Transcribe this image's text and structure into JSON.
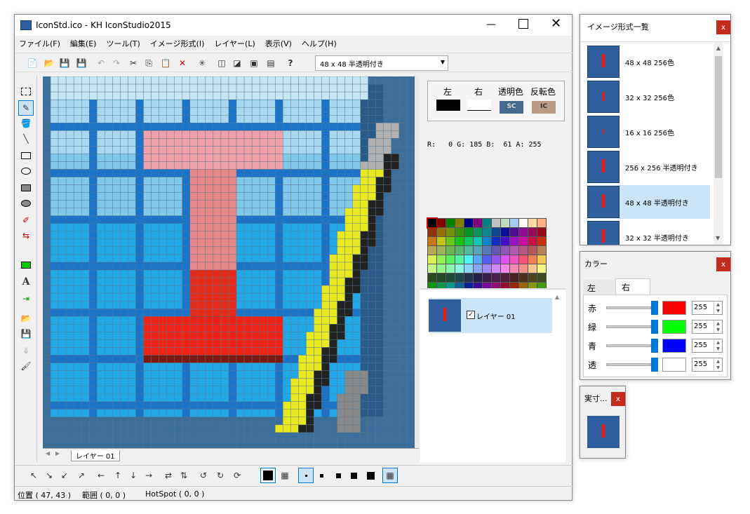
{
  "main": {
    "title": "IconStd.ico - KH IconStudio2015",
    "menu": [
      "ファイル(F)",
      "編集(E)",
      "ツール(T)",
      "イメージ形式(I)",
      "レイヤー(L)",
      "表示(V)",
      "ヘルプ(H)"
    ],
    "format_select": "48 x 48 半透明付き",
    "layer_tab": "レイヤー 01",
    "status": {
      "pos": "位置 ( 47, 43 )",
      "range": "範囲 ( 0, 0 )",
      "hotspot": "HotSpot ( 0, 0 )"
    }
  },
  "colors_panel": {
    "left_label": "左",
    "right_label": "右",
    "trans_label": "透明色",
    "inv_label": "反転色",
    "sc": "SC",
    "ic": "IC",
    "rgba": "R:   0 G: 185 B:  61 A: 255"
  },
  "layers": [
    {
      "name": "レイヤー 01",
      "checked": true
    }
  ],
  "formats_window": {
    "title": "イメージ形式一覧",
    "items": [
      "48 x 48 256色",
      "32 x 32 256色",
      "16 x 16 256色",
      "256 x 256 半透明付き",
      "48 x 48 半透明付き",
      "32 x 32 半透明付き"
    ]
  },
  "color_window": {
    "title": "カラー",
    "tab_left": "左",
    "tab_right": "右",
    "rows": [
      {
        "label": "赤",
        "value": "255",
        "color": "#ff0000"
      },
      {
        "label": "緑",
        "value": "255",
        "color": "#00ff00"
      },
      {
        "label": "青",
        "value": "255",
        "color": "#0000ff"
      },
      {
        "label": "透",
        "value": "255",
        "color": "#ffffff"
      }
    ]
  },
  "actual_window": {
    "title": "実寸..."
  },
  "close_glyph": "x"
}
